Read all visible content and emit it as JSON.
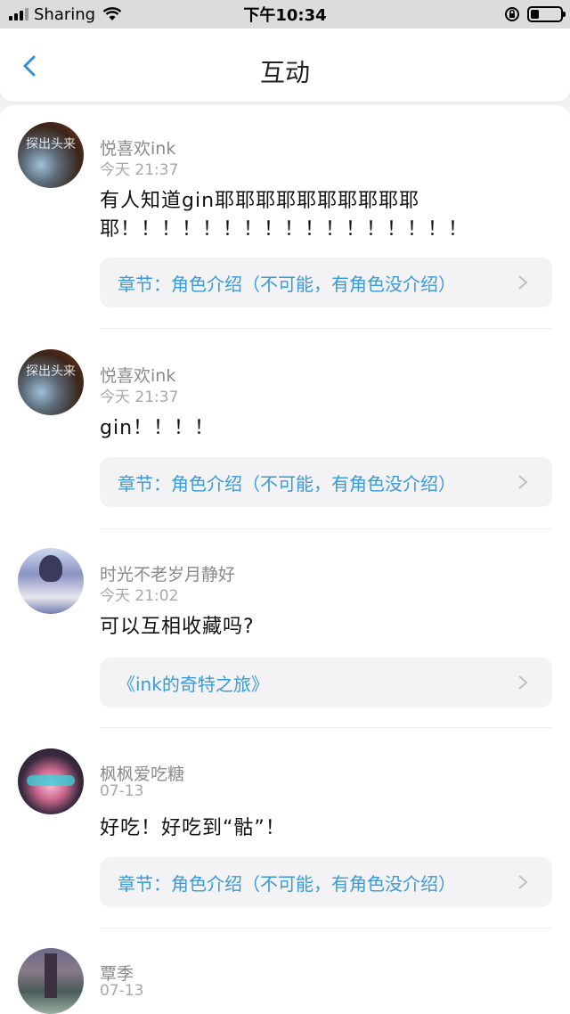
{
  "status": {
    "carrier": "Sharing",
    "time": "下午10:34"
  },
  "nav": {
    "title": "互动"
  },
  "comments": [
    {
      "user": "悦喜欢ink",
      "time": "今天 21:37",
      "text": "有人知道gin耶耶耶耶耶耶耶耶耶耶耶！！！！！！！！！！！！！！！！！",
      "link": "章节：角色介绍（不可能，有角色没介绍）",
      "avatar_icon": "avatar-image"
    },
    {
      "user": "悦喜欢ink",
      "time": "今天 21:37",
      "text": "gin！！！！",
      "link": "章节：角色介绍（不可能，有角色没介绍）",
      "avatar_icon": "avatar-image"
    },
    {
      "user": "时光不老岁月静好",
      "time": "今天 21:02",
      "text": "可以互相收藏吗?",
      "link": "《ink的奇特之旅》",
      "avatar_icon": "avatar-image"
    },
    {
      "user": "枫枫爱吃糖",
      "time": "07-13",
      "text": "好吃！好吃到“骷”！",
      "link": "章节：角色介绍（不可能，有角色没介绍）",
      "avatar_icon": "avatar-image"
    },
    {
      "user": "覃季",
      "time": "07-13",
      "avatar_icon": "avatar-image"
    }
  ],
  "avatar_overlay_text": "探出头来",
  "colors": {
    "accent": "#3a9ad9",
    "back": "#2f8fd6"
  }
}
